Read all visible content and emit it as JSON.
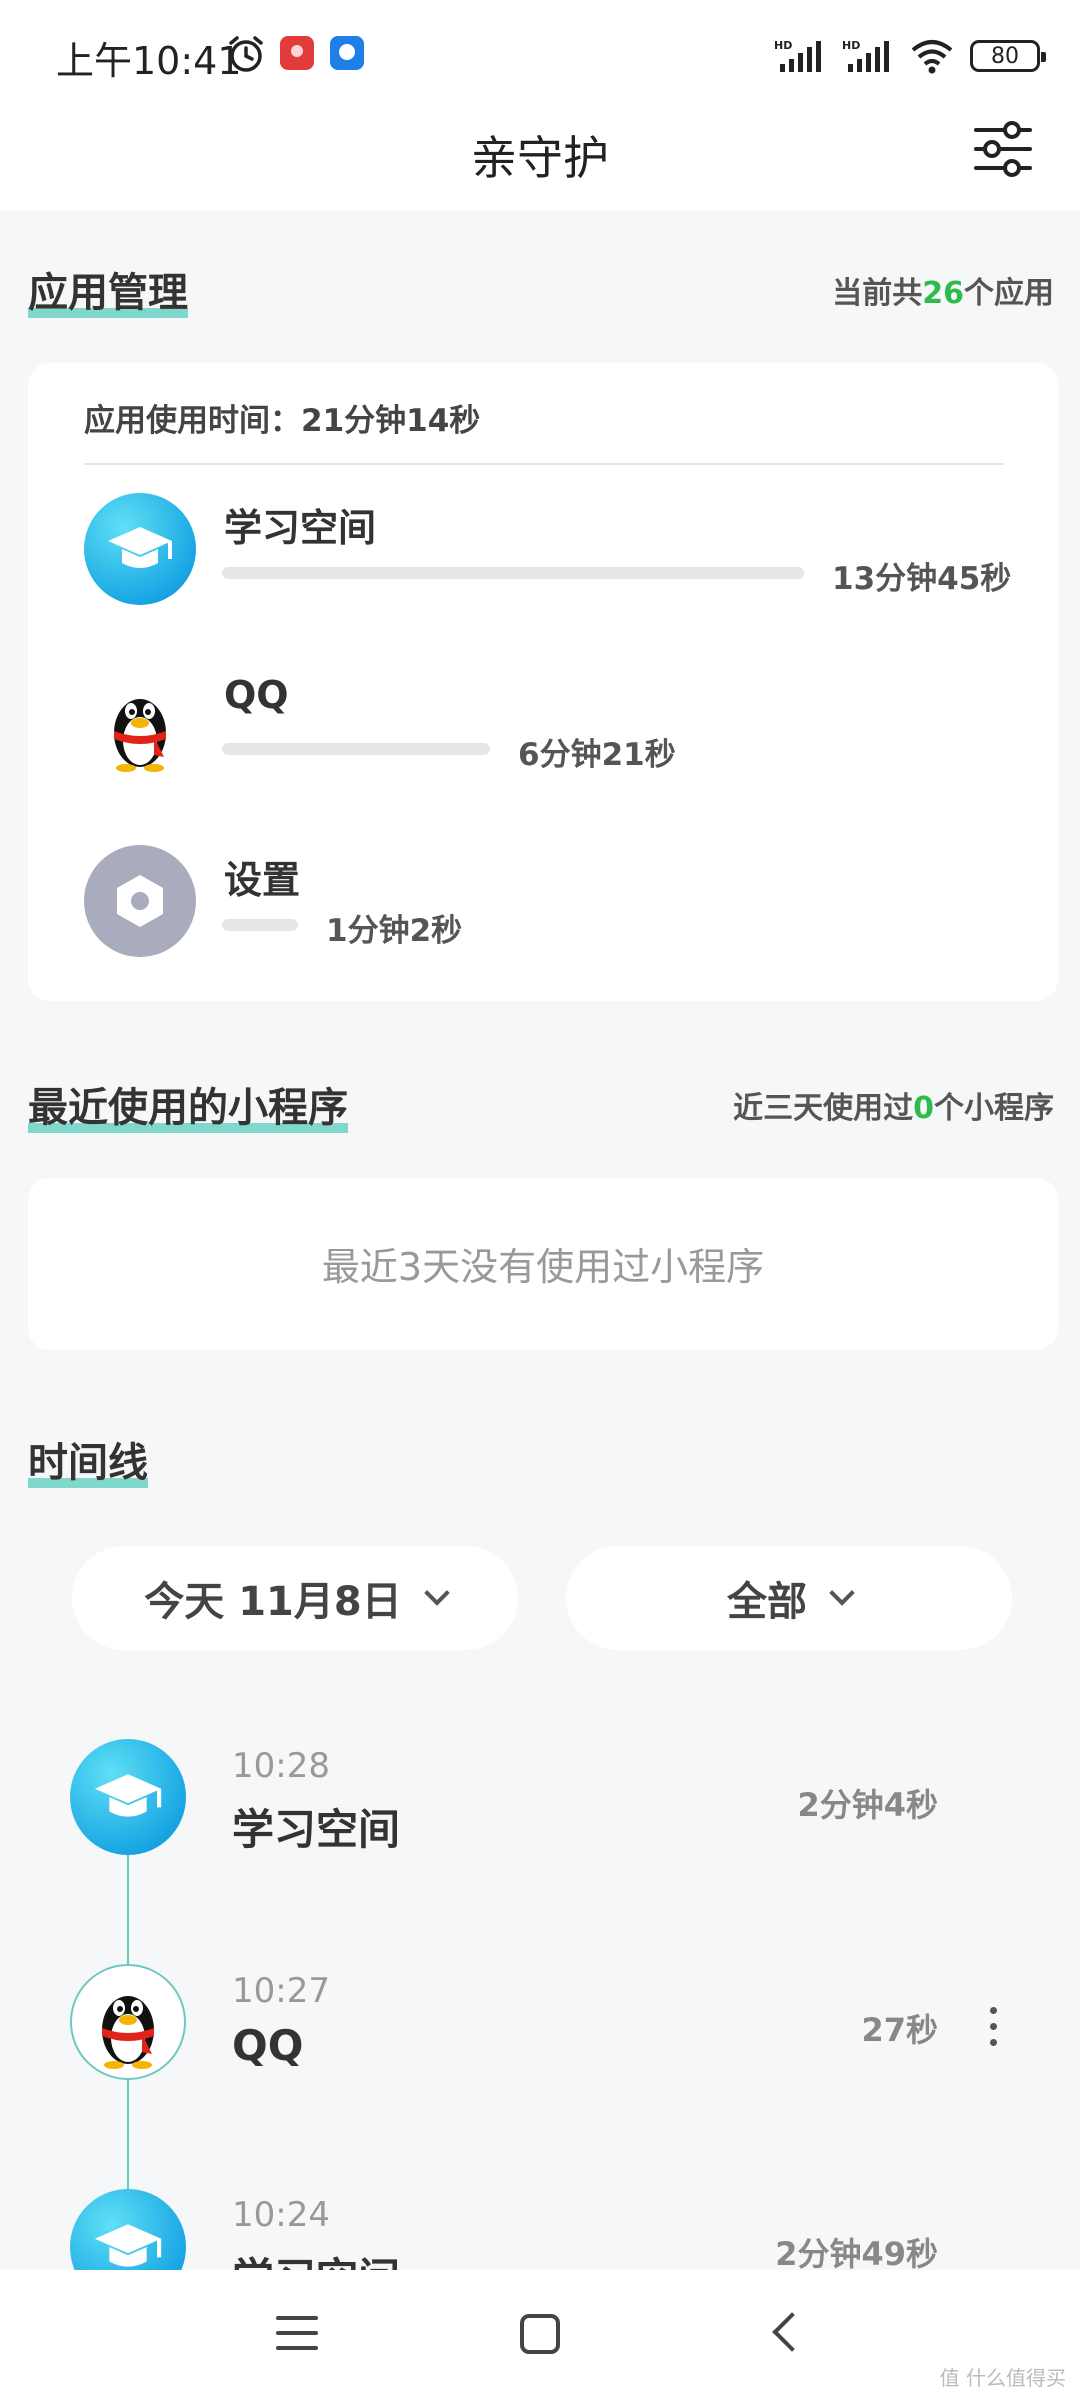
{
  "status_bar": {
    "time": "上午10:41",
    "battery": "80"
  },
  "header": {
    "title": "亲守护"
  },
  "app_management": {
    "title": "应用管理",
    "count_prefix": "当前共",
    "count": "26",
    "count_suffix": "个应用",
    "usage_label": "应用使用时间：21分钟14秒",
    "apps": [
      {
        "name": "学习空间",
        "time": "13分钟45秒",
        "share": 1.0
      },
      {
        "name": "QQ",
        "time": "6分钟21秒",
        "share": 0.46
      },
      {
        "name": "设置",
        "time": "1分钟2秒",
        "share": 0.13
      }
    ]
  },
  "mini_programs": {
    "title": "最近使用的小程序",
    "count_prefix": "近三天使用过",
    "count": "0",
    "count_suffix": "个小程序",
    "empty_text": "最近3天没有使用过小程序"
  },
  "timeline": {
    "title": "时间线",
    "date_filter": "今天 11月8日",
    "type_filter": "全部",
    "entries": [
      {
        "time": "10:28",
        "name": "学习空间",
        "duration": "2分钟4秒"
      },
      {
        "time": "10:27",
        "name": "QQ",
        "duration": "27秒"
      },
      {
        "time": "10:24",
        "name": "学习空间",
        "duration": "2分钟49秒"
      }
    ]
  },
  "watermark": "值 什么值得买"
}
